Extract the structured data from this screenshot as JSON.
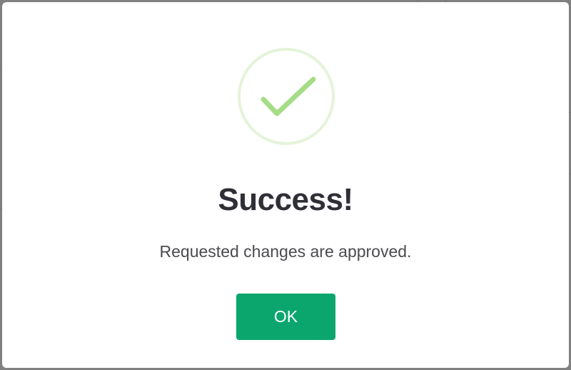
{
  "dialog": {
    "title": "Success!",
    "message": "Requested changes are approved.",
    "ok_label": "OK",
    "icon": "check-mark-icon"
  },
  "colors": {
    "accent": "#0aa66e",
    "check": "#a5dc86",
    "overlay": "#808080",
    "title": "#2f2f36",
    "message": "#4a4a50"
  }
}
